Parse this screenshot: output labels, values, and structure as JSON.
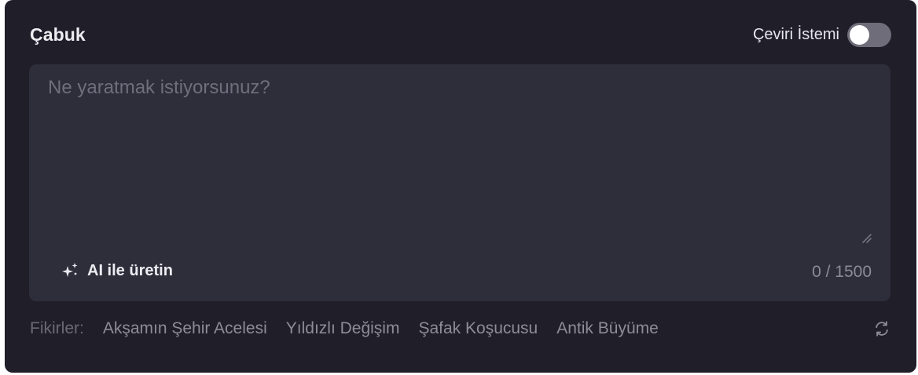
{
  "header": {
    "title": "Çabuk",
    "toggle_label": "Çeviri İstemi",
    "toggle_on": false
  },
  "prompt": {
    "placeholder": "Ne yaratmak istiyorsunuz?",
    "value": "",
    "ai_button_label": "AI ile üretin",
    "ai_icon": "sparkle-icon",
    "counter": "0 / 1500"
  },
  "ideas": {
    "label": "Fikirler:",
    "items": [
      "Akşamın Şehir Acelesi",
      "Yıldızlı Değişim",
      "Şafak Koşucusu",
      "Antik Büyüme"
    ],
    "refresh_icon": "refresh-icon"
  },
  "colors": {
    "panel_bg": "#1f1e29",
    "input_bg": "#2e2d3a",
    "toggle_off": "#6e6d79",
    "text_primary": "#ececf1",
    "text_muted": "#8d8c98"
  }
}
